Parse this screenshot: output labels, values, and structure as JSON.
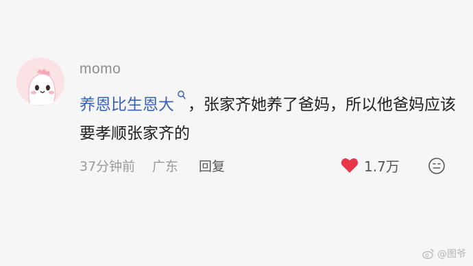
{
  "comment": {
    "username": "momo",
    "highlighted_text": "养恩比生恩大",
    "body_text": "，张家齐她养了爸妈，所以他爸妈应该要孝顺张家齐的",
    "time": "37分钟前",
    "location": "广东",
    "reply_label": "回复",
    "like_count": "1.7万",
    "liked": true
  },
  "icons": {
    "avatar": "pink-dino-avatar",
    "search": "search-icon",
    "like": "heart-icon",
    "emoji": "emoji-icon",
    "watermark": "weibo-icon"
  },
  "colors": {
    "link": "#3a63b8",
    "heart": "#e8354a",
    "background": "#f6f6f6"
  },
  "watermark": {
    "text": "@图爷"
  }
}
